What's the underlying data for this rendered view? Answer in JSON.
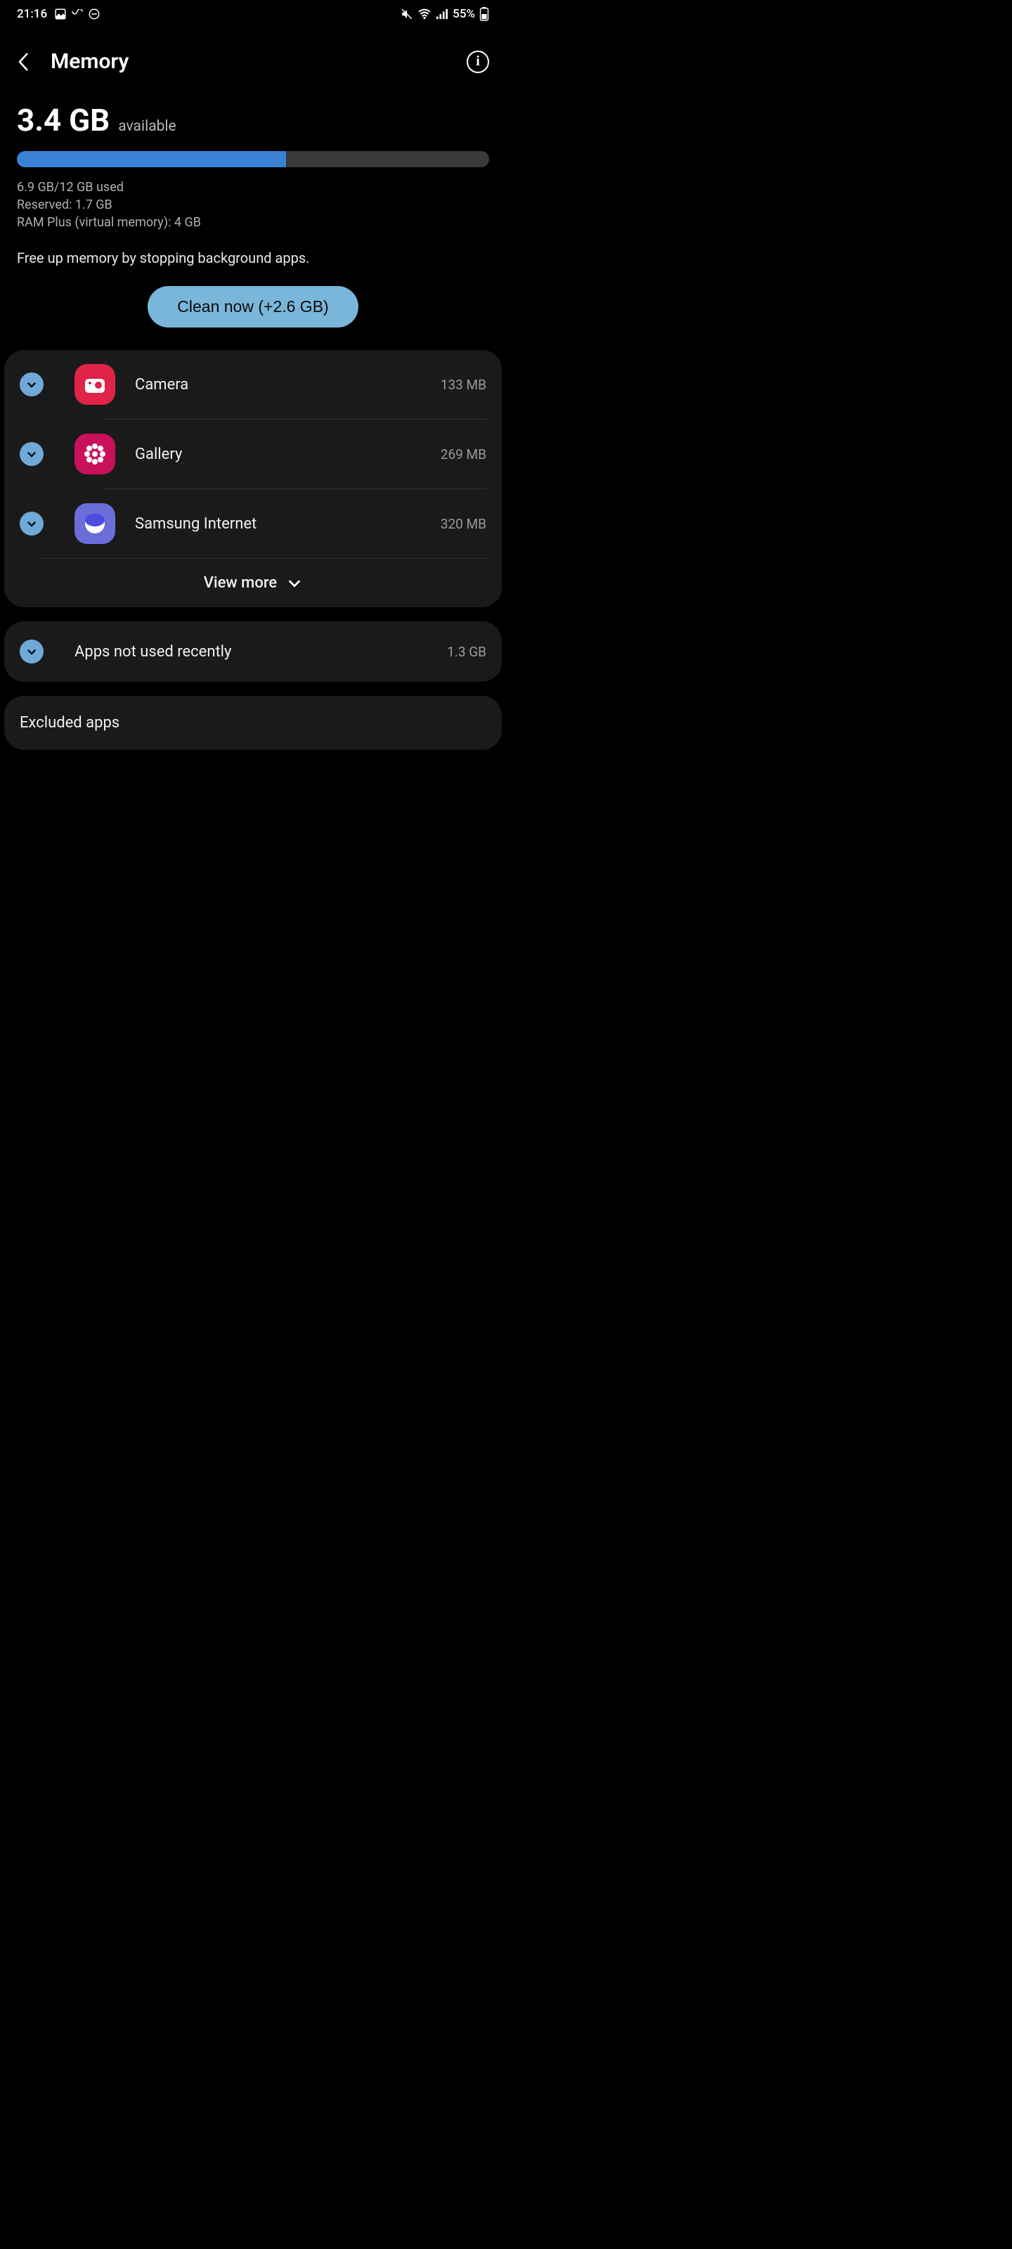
{
  "status": {
    "time": "21:16",
    "battery": "55%"
  },
  "header": {
    "title": "Memory"
  },
  "memory": {
    "available_amount": "3.4 GB",
    "available_label": "available",
    "progress_percent": 57,
    "used_line": "6.9 GB/12 GB used",
    "reserved_line": "Reserved: 1.7 GB",
    "ramplus_line": "RAM Plus (virtual memory): 4 GB",
    "help_text": "Free up memory by stopping background apps.",
    "clean_button": "Clean now (+2.6 GB)"
  },
  "apps": [
    {
      "name": "Camera",
      "size": "133 MB",
      "checked": true,
      "icon": "camera"
    },
    {
      "name": "Gallery",
      "size": "269 MB",
      "checked": true,
      "icon": "gallery"
    },
    {
      "name": "Samsung Internet",
      "size": "320 MB",
      "checked": true,
      "icon": "internet"
    }
  ],
  "view_more": "View more",
  "not_recent": {
    "label": "Apps not used recently",
    "size": "1.3 GB",
    "checked": true
  },
  "excluded": {
    "label": "Excluded apps"
  }
}
